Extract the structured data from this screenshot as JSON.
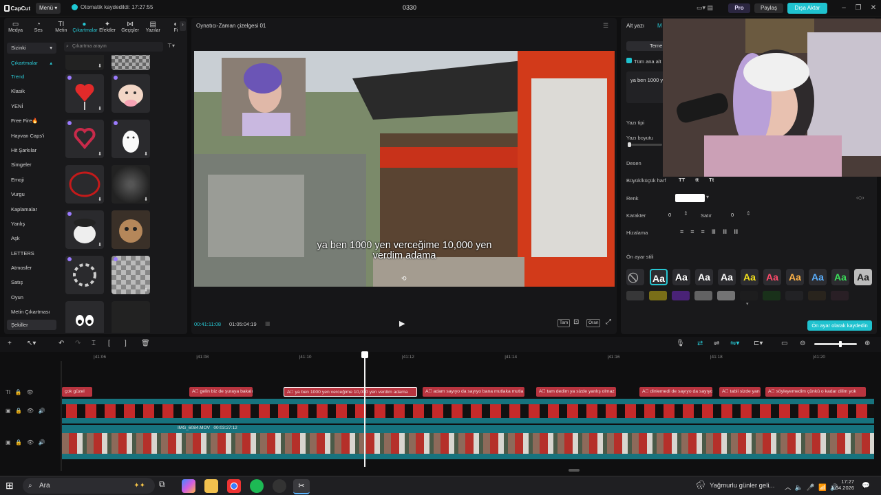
{
  "titlebar": {
    "logo": "CapCut",
    "menu": "Menü",
    "autosave": "Otomatik kaydedildi: 17:27:55",
    "project": "0330",
    "pro": "Pro",
    "share": "Paylaş",
    "export": "Dışa Aktar"
  },
  "tabs": [
    {
      "label": "Medya",
      "icon": "media-icon",
      "glyph": "▭"
    },
    {
      "label": "Ses",
      "icon": "audio-icon",
      "glyph": "◔"
    },
    {
      "label": "Metin",
      "icon": "text-icon",
      "glyph": "TI"
    },
    {
      "label": "Çıkartmalar",
      "icon": "sticker-icon",
      "glyph": "●"
    },
    {
      "label": "Efektler",
      "icon": "effects-icon",
      "glyph": "✦"
    },
    {
      "label": "Geçişler",
      "icon": "transitions-icon",
      "glyph": "⋈"
    },
    {
      "label": "Yazılar",
      "icon": "captions-icon",
      "glyph": "▤"
    },
    {
      "label": "Fi",
      "icon": "filters-icon",
      "glyph": "◐"
    }
  ],
  "sidebar": {
    "dropdown": "Sizinki",
    "section": "Çıkartmalar",
    "items": [
      "Trend",
      "Klasik",
      "YENİ",
      "Free Fire🔥",
      "Hayvan Caps'i",
      "Hit Şarkılar",
      "Simgeler",
      "Emoji",
      "Vurgu",
      "Kaplamalar",
      "Yanlış",
      "Aşk",
      "LETTERS",
      "Atmosfer",
      "Satış",
      "Oyun",
      "Metin Çıkartması",
      "Şekiller"
    ]
  },
  "search": {
    "placeholder": "Çıkartma arayın"
  },
  "player": {
    "title": "Oynatıcı-Zaman çizelgesi 01",
    "subtitle_line1": "ya ben 1000 yen verceğime 10,000 yen",
    "subtitle_line2": "verdim adama",
    "current": "00:41:11:08",
    "total": "01:05:04:19",
    "btn_full": "Tam",
    "btn_ratio": "Oran"
  },
  "right": {
    "tab1": "Alt yazı",
    "tab2": "M",
    "temel": "Teme",
    "checkbox": "Tüm ana alt",
    "textvalue": "ya ben 1000 y",
    "font": "Yazı tipi",
    "size": "Yazı boyutu",
    "pattern": "Desen",
    "case": "Büyük/küçük harf",
    "case_opts": [
      "TT",
      "tt",
      "Tt"
    ],
    "color": "Renk",
    "char": "Karakter",
    "char_val": "0",
    "line": "Satır",
    "line_val": "0",
    "align": "Hizalama",
    "preset": "Ön ayar stili",
    "save_preset": "Ön ayar olarak kaydedin",
    "preset_colors": [
      "#ffffff",
      "#ffffff",
      "#ffffff",
      "#ffffff",
      "#f5e21b",
      "#ff4b6b",
      "#ffb347",
      "#5ab0ff",
      "#3be05a",
      "#222222"
    ]
  },
  "timeline": {
    "ticks": [
      "|41:06",
      "|41:08",
      "|41:10",
      "|41:12",
      "|41:14",
      "|41:16",
      "|41:18",
      "|41:20"
    ],
    "captions": [
      "çok güzel",
      "gelin biz de şuraya bakalı",
      "ya ben 1000 yen verceğime 10,000 yen verdim adama",
      "adam sayıyo da sayıyo bana mutlaka mutla",
      "tam dedim ya sizde yanlış olmaz",
      "dinlemedi de sayıyo da sayıyo",
      "tabii sizde yan",
      "söyleyemedim çünkü o kadar dilim yok"
    ],
    "clip_name": "IMG_6084.MOV",
    "clip_dur": "00:03:27:12"
  },
  "taskbar": {
    "search": "Ara",
    "weather": "Yağmurlu günler geli...",
    "time": "17:27",
    "date": "1.04.2026"
  }
}
